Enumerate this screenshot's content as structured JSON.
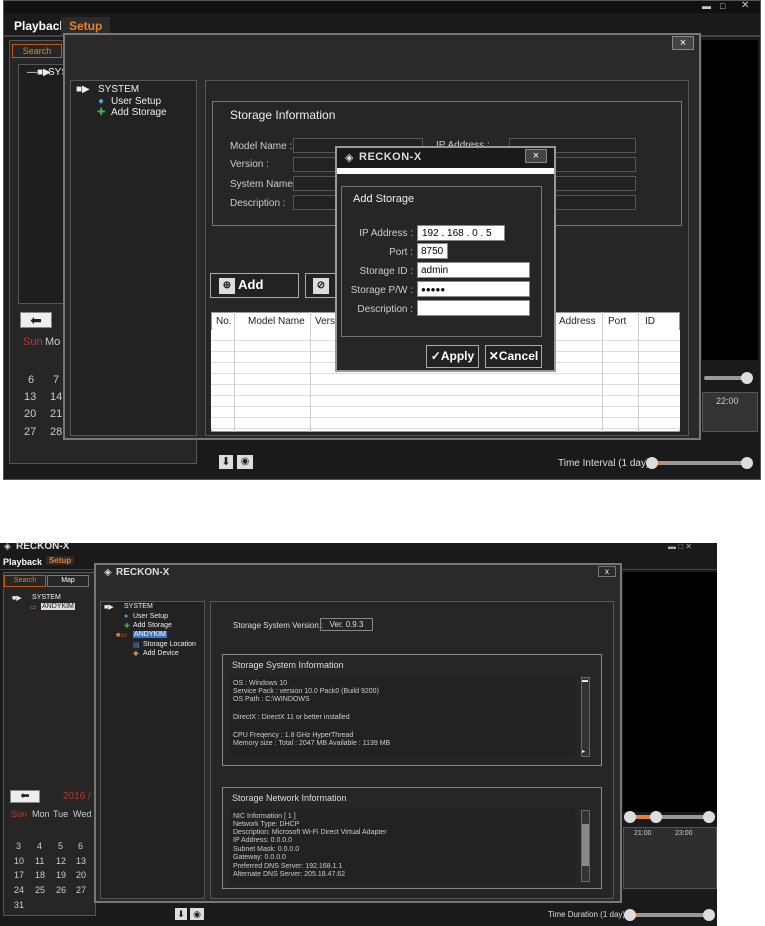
{
  "top": {
    "tabs": [
      "Playback",
      "Setup"
    ],
    "search_tab": "Search",
    "tree_partial": "SYS",
    "calendar": {
      "headers": [
        "Sun",
        "Mo"
      ],
      "rows": [
        [
          "6",
          "7"
        ],
        [
          "13",
          "14"
        ],
        [
          "20",
          "21"
        ],
        [
          "27",
          "28"
        ]
      ]
    },
    "dialog": {
      "close": "×",
      "tree": [
        "SYSTEM",
        "User Setup",
        "Add Storage"
      ],
      "storage_info": {
        "title": "Storage Information",
        "labels": [
          "Model Name :",
          "Version :",
          "System Name :",
          "Description :"
        ],
        "ip_label_partial": "IP Address :"
      },
      "add_button": "Add",
      "table_headers": [
        "No.",
        "Model Name",
        "Versi",
        "Address",
        "Port",
        "ID"
      ]
    },
    "popup": {
      "brand": "RECKON-X",
      "close": "×",
      "title": "Add Storage",
      "labels": {
        "ip": "IP Address :",
        "port": "Port :",
        "id": "Storage ID :",
        "pw": "Storage P/W :",
        "desc": "Description :"
      },
      "ip_octets": [
        "192",
        "168",
        "0",
        "5"
      ],
      "port": "8750",
      "storage_id": "admin",
      "password": "●●●●●",
      "description": "",
      "apply": "Apply",
      "cancel": "Cancel"
    },
    "time_label": "22:00",
    "time_interval": "Time Interval (1 day)"
  },
  "bottom": {
    "brand": "RECKON-X",
    "tabs": [
      "Playback",
      "Setup"
    ],
    "search_tabs": [
      "Search",
      "Map"
    ],
    "tree": [
      "SYSTEM",
      "ANDYKIM"
    ],
    "year": "2016 /",
    "calendar": {
      "headers": [
        "Sun",
        "Mon",
        "Tue",
        "Wed"
      ],
      "rows": [
        [
          "3",
          "4",
          "5",
          "6"
        ],
        [
          "10",
          "11",
          "12",
          "13"
        ],
        [
          "17",
          "18",
          "19",
          "20"
        ],
        [
          "24",
          "25",
          "26",
          "27"
        ],
        [
          "31",
          "",
          "",
          ""
        ]
      ]
    },
    "dialog": {
      "brand": "RECKON-X",
      "close": "x",
      "tree": [
        "SYSTEM",
        "User Setup",
        "Add Storage",
        "ANDYKIM",
        "Storage Location",
        "Add Device"
      ],
      "version_label": "Storage System Version :",
      "version_value": "Ver. 0.9.3",
      "sys_info_title": "Storage System Information",
      "sys_info_lines": [
        "OS : Windows 10",
        "Service Pack : version 10.0 Pack0 (Build 9200)",
        "OS Path : C:\\WINDOWS",
        "",
        "DirectX : DirectX 11 or better installed",
        "",
        "CPU Freqency : 1.8 GHz HyperThread",
        "Memory size : Total : 2047 MB       Available : 1139 MB"
      ],
      "net_info_title": "Storage Network Information",
      "net_info_lines": [
        "NIC Information [ 1 ]",
        "Network Type: DHCP",
        "Description: Microsoft Wi-Fi Direct Virtual Adapter",
        "IP Address: 0.0.0.0",
        "Subnet Mask: 0.0.0.0",
        "Gateway: 0.0.0.0",
        "Preferred DNS Server: 192.168.1.1",
        "Alternate DNS Server: 205.18.47.62"
      ]
    },
    "times": [
      "21:00",
      "23:00"
    ],
    "time_duration": "Time Duration (1 day)"
  }
}
